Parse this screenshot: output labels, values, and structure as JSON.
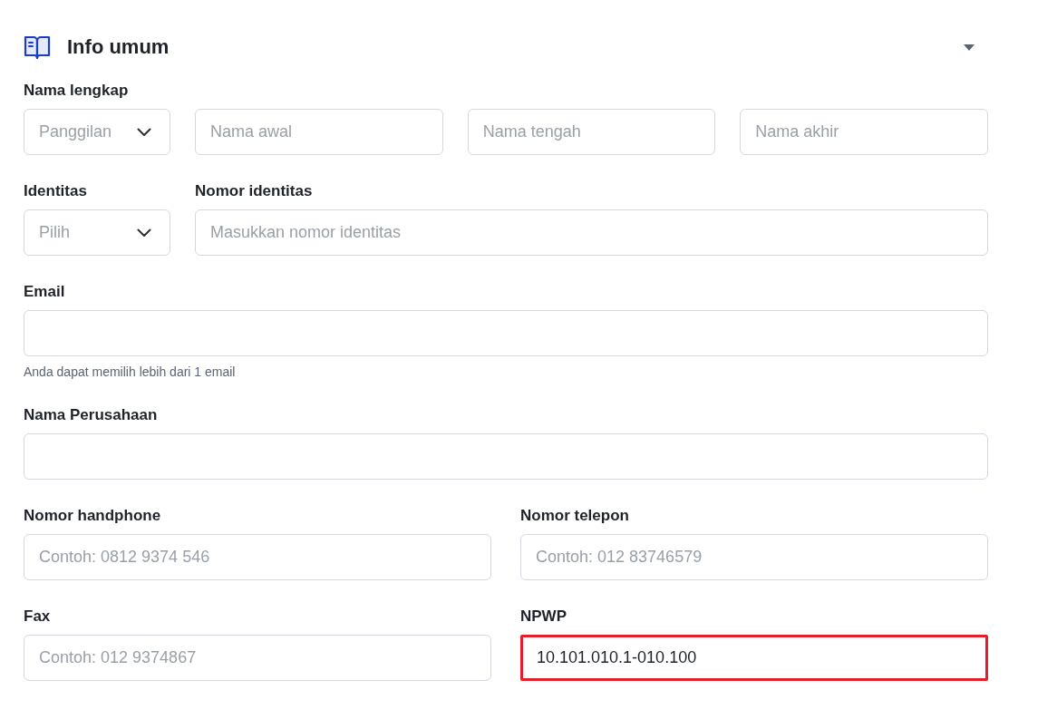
{
  "section": {
    "title": "Info umum",
    "expanded": true
  },
  "groups": [
    {
      "kind": "name",
      "label": "Nama lengkap",
      "fields": [
        {
          "kind": "select",
          "placeholder": "Panggilan"
        },
        {
          "kind": "input",
          "placeholder": "Nama awal"
        },
        {
          "kind": "input",
          "placeholder": "Nama tengah"
        },
        {
          "kind": "input",
          "placeholder": "Nama akhir"
        }
      ]
    },
    {
      "kind": "identity",
      "fields": [
        {
          "kind": "select",
          "label": "Identitas",
          "placeholder": "Pilih"
        },
        {
          "kind": "input",
          "label": "Nomor identitas",
          "placeholder": "Masukkan nomor identitas"
        }
      ]
    },
    {
      "kind": "single",
      "fields": [
        {
          "kind": "input",
          "label": "Email",
          "helper": "Anda dapat memilih lebih dari 1 email"
        }
      ]
    },
    {
      "kind": "single",
      "fields": [
        {
          "kind": "input",
          "label": "Nama Perusahaan"
        }
      ]
    },
    {
      "kind": "pair",
      "fields": [
        {
          "kind": "input",
          "label": "Nomor handphone",
          "placeholder": "Contoh: 0812 9374 546"
        },
        {
          "kind": "input",
          "label": "Nomor telepon",
          "placeholder": "Contoh: 012 83746579"
        }
      ]
    },
    {
      "kind": "pair",
      "fields": [
        {
          "kind": "input",
          "label": "Fax",
          "placeholder": "Contoh: 012 9374867"
        },
        {
          "kind": "input",
          "label": "NPWP",
          "value": "10.101.010.1-010.100",
          "highlighted": true
        }
      ]
    }
  ]
}
